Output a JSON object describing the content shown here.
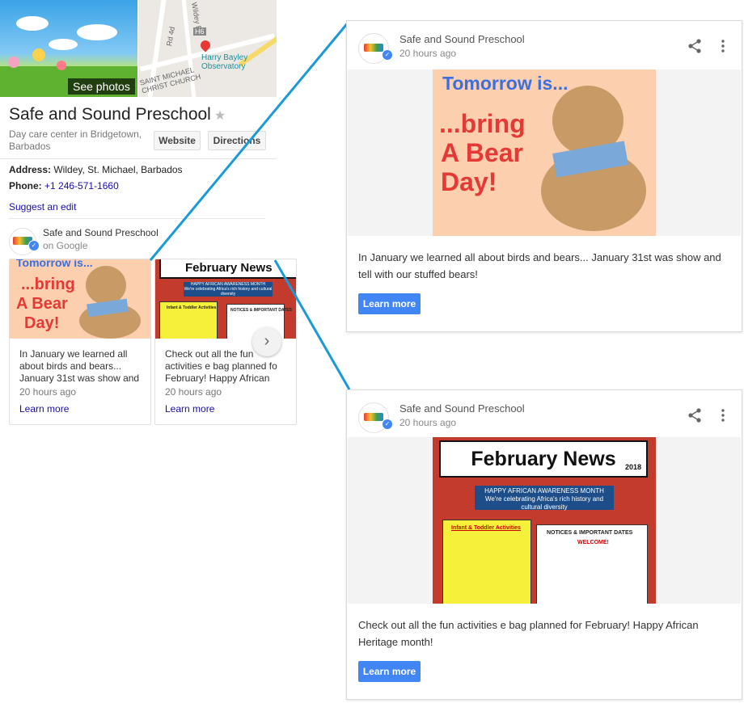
{
  "panel": {
    "see_photos": "See photos",
    "map_labels": {
      "road1": "Rd 4d",
      "road2": "Wildey Rd",
      "highway": "H6",
      "church": "SAINT MICHAEL CHRIST CHURCH",
      "place": "Harry Bayley Observatory"
    },
    "title": "Safe and Sound Preschool",
    "star": "★",
    "subtitle": "Day care center in Bridgetown, Barbados",
    "website_btn": "Website",
    "directions_btn": "Directions",
    "address_label": "Address:",
    "address_value": "Wildey, St. Michael, Barbados",
    "phone_label": "Phone:",
    "phone_value": "+1 246-571-1660",
    "suggest_edit": "Suggest an edit",
    "poster_name": "Safe and Sound Preschool",
    "poster_on": "on Google"
  },
  "posts": [
    {
      "author": "Safe and Sound Preschool",
      "time": "20 hours ago",
      "short_text": "In January we learned all about birds and bears... January 31st was show and",
      "full_text": "In January we learned all about birds and bears... January 31st was show and tell with our stuffed bears!",
      "learn_more": "Learn more",
      "art": {
        "top": "Tomorrow is...",
        "line1": "...bring",
        "line2": "A Bear",
        "line3": "Day!"
      }
    },
    {
      "author": "Safe and Sound Preschool",
      "time": "20 hours ago",
      "short_text": "Check out all the fun activities e bag planned fo February! Happy African",
      "full_text": "Check out all the fun activities e bag planned for February! Happy African Heritage month!",
      "learn_more": "Learn more",
      "art": {
        "title": "February News",
        "year": "2018",
        "band1": "HAPPY AFRICAN AWARENESS MONTH",
        "band2": "We're celebrating Africa's rich history and cultural diversity",
        "box1": "Infant & Toddler Activities",
        "box2": "NOTICES & IMPORTANT DATES",
        "welcome": "WELCOME!"
      }
    }
  ],
  "icons": {
    "share": "share-icon",
    "menu": "more-vert-icon",
    "expand": "expand-icon",
    "next": "chevron-right-icon",
    "verified": "verified-check-icon"
  },
  "colors": {
    "accent_blue": "#4285f4",
    "connector": "#1a9ad6",
    "link": "#1a0dab"
  }
}
